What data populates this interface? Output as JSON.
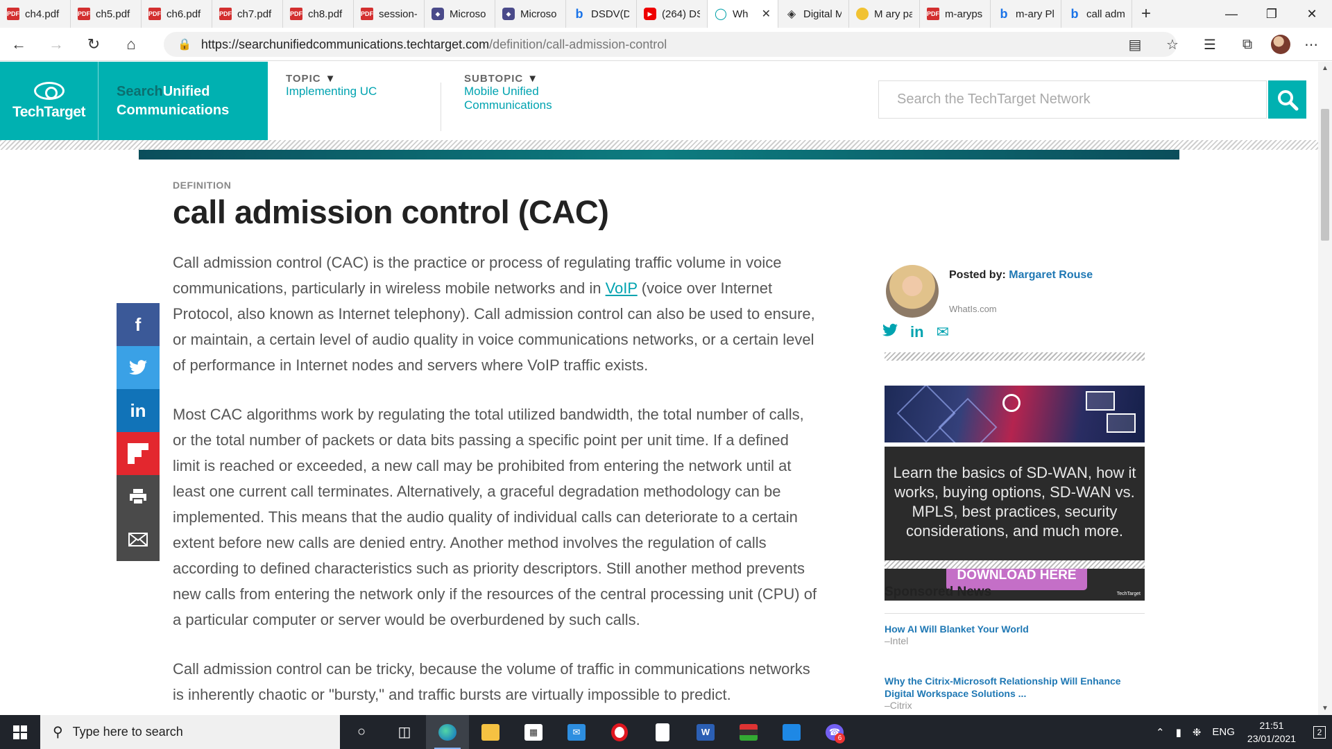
{
  "browser": {
    "tabs": [
      {
        "label": "ch4.pdf",
        "icon": "pdf-icon",
        "kind": "pdf"
      },
      {
        "label": "ch5.pdf",
        "icon": "pdf-icon",
        "kind": "pdf"
      },
      {
        "label": "ch6.pdf",
        "icon": "pdf-icon",
        "kind": "pdf"
      },
      {
        "label": "ch7.pdf",
        "icon": "pdf-icon",
        "kind": "pdf"
      },
      {
        "label": "ch8.pdf",
        "icon": "pdf-icon",
        "kind": "pdf"
      },
      {
        "label": "session-",
        "icon": "pdf-icon",
        "kind": "pdf"
      },
      {
        "label": "Microso",
        "icon": "shield-icon",
        "kind": "ms"
      },
      {
        "label": "Microso",
        "icon": "shield-icon",
        "kind": "ms"
      },
      {
        "label": "DSDV(D",
        "icon": "bing-icon",
        "kind": "bing"
      },
      {
        "label": "(264) DS",
        "icon": "youtube-icon",
        "kind": "yt"
      },
      {
        "label": "Wh",
        "icon": "techtarget-icon",
        "kind": "tt",
        "active": true
      },
      {
        "label": "Digital M",
        "icon": "diamond-icon",
        "kind": "dg"
      },
      {
        "label": "M ary pa",
        "icon": "cup-icon",
        "kind": "ma"
      },
      {
        "label": "m-aryps",
        "icon": "pdf-icon",
        "kind": "pdf"
      },
      {
        "label": "m-ary Pl",
        "icon": "bing-icon",
        "kind": "bing"
      },
      {
        "label": "call adm",
        "icon": "bing-icon",
        "kind": "bing"
      }
    ],
    "url_host": "https://searchunifiedcommunications.techtarget.com",
    "url_path": "/definition/call-admission-control"
  },
  "site": {
    "brand": "TechTarget",
    "name_search": "Search",
    "name_unified": "Unified",
    "name_comm": "Communications",
    "topic_label": "TOPIC",
    "topic_value": "Implementing UC",
    "subtopic_label": "SUBTOPIC",
    "subtopic_value_1": "Mobile Unified",
    "subtopic_value_2": "Communications",
    "search_placeholder": "Search the TechTarget Network",
    "accent": "#00b1b1",
    "link": "#00a3b0"
  },
  "article": {
    "kicker": "DEFINITION",
    "title": "call admission control (CAC)",
    "p1_a": "Call admission control (CAC) is the practice or process of regulating traffic volume in voice communications, particularly in wireless mobile networks and in ",
    "p1_link": "VoIP",
    "p1_b": " (voice over Internet Protocol, also known as Internet telephony). Call admission control can also be used to ensure, or maintain, a certain level of audio quality in voice communications networks, or a certain level of performance in Internet nodes and servers where VoIP traffic exists.",
    "p2": "Most CAC algorithms work by regulating the total utilized bandwidth, the total number of calls, or the total number of packets or data bits passing a specific point per unit time. If a defined limit is reached or exceeded, a new call may be prohibited from entering the network until at least one current call terminates. Alternatively, a graceful degradation methodology can be implemented. This means that the audio quality of individual calls can deteriorate to a certain extent before new calls are denied entry. Another method involves the regulation of calls according to defined characteristics such as priority descriptors. Still another method prevents new calls from entering the network only if the resources of the central processing unit (CPU) of a particular computer or server would be overburdened by such calls.",
    "p3": "Call admission control can be tricky, because the volume of traffic in communications networks is inherently chaotic or \"bursty,\" and traffic bursts are virtually impossible to predict."
  },
  "author": {
    "posted_by": "Posted by:",
    "name": "Margaret Rouse",
    "source": "WhatIs.com"
  },
  "ad": {
    "text": "Learn the basics of SD-WAN, how it works, buying options, SD-WAN vs. MPLS, best practices, security considerations, and much more.",
    "button": "DOWNLOAD HERE",
    "mini_brand": "TechTarget"
  },
  "sponsored": {
    "title": "Sponsored News",
    "items": [
      {
        "title": "How AI Will Blanket Your World",
        "source": "–Intel"
      },
      {
        "title": "Why the Citrix-Microsoft Relationship Will Enhance Digital Workspace Solutions ...",
        "source": "–Citrix"
      }
    ]
  },
  "taskbar": {
    "search_placeholder": "Type here to search",
    "lang": "ENG",
    "time": "21:51",
    "date": "23/01/2021",
    "notifications": "2",
    "viber_badge": "6"
  }
}
